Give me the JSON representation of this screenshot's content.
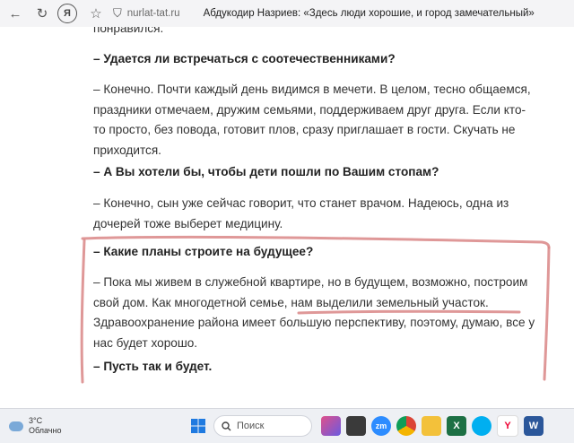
{
  "browser": {
    "back_glyph": "←",
    "refresh_glyph": "↻",
    "yandex_glyph": "Я",
    "bookmark_glyph": "☆",
    "shield_glyph": "⛉",
    "url": "nurlat-tat.ru",
    "title": "Абдукодир Назриев: «Здесь люди хорошие, и город замечательный»"
  },
  "article": {
    "prev_tail": "понравился.",
    "q1": "– Удается ли встречаться с соотечественниками?",
    "a1_lines": [
      "– Конечно. Почти каждый день видимся в мечети. В целом, тесно общаемся,",
      "праздники отмечаем, дружим семьями, поддерживаем друг друга. Если кто-",
      "то просто, без повода, готовит плов, сразу приглашает в гости. Скучать не",
      "приходится."
    ],
    "q2": "– А Вы хотели бы, чтобы дети пошли по Вашим стопам?",
    "a2_lines": [
      "– Конечно, сын уже сейчас говорит, что станет врачом. Надеюсь, одна из",
      "дочерей тоже выберет медицину."
    ],
    "q3": "– Какие планы строите на будущее?",
    "a3_line1": "– Пока мы живем в служебной квартире, но в будущем, возможно, построим",
    "a3_line2_pre": "свой дом. Как многодетной семье, ",
    "a3_line2_hl": "нам выделили земельный участок.",
    "a3_line3": "Здравоохранение района имеет большую перспективу, поэтому, думаю, все у",
    "a3_line4": "нас будет хорошо.",
    "q4": "– Пусть так и будет."
  },
  "colors": {
    "marker": "#d98686",
    "weather_cloud": "#7aa9d8"
  },
  "taskbar": {
    "weather_temp": "3°C",
    "weather_desc": "Облачно",
    "search_placeholder": "Поиск",
    "zoom_label": "zm",
    "word_label": "W",
    "yandex_label": "Y",
    "excel_label": "X"
  }
}
